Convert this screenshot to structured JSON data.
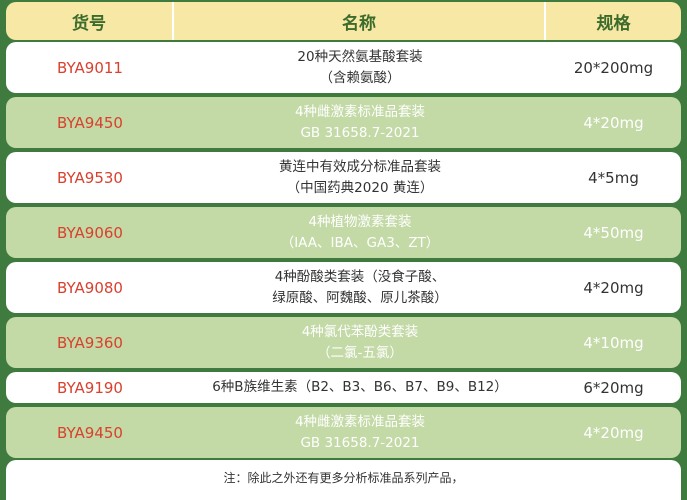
{
  "header": {
    "col_code": "货号",
    "col_name": "名称",
    "col_spec": "规格"
  },
  "rows": [
    {
      "code": "BYA9011",
      "name_line1": "20种天然氨基酸套装",
      "name_line2": "（含赖氨酸）",
      "spec": "20*200mg",
      "style": "white"
    },
    {
      "code": "BYA9450",
      "name_line1": "4种雌激素标准品套装",
      "name_line2": "GB 31658.7-2021",
      "spec": "4*20mg",
      "style": "green"
    },
    {
      "code": "BYA9530",
      "name_line1": "黄连中有效成分标准品套装",
      "name_line2": "（中国药典2020 黄连）",
      "spec": "4*5mg",
      "style": "white"
    },
    {
      "code": "BYA9060",
      "name_line1": "4种植物激素套装",
      "name_line2": "（IAA、IBA、GA3、ZT）",
      "spec": "4*50mg",
      "style": "green"
    },
    {
      "code": "BYA9080",
      "name_line1": "4种酚酸类套装（没食子酸、",
      "name_line2": "绿原酸、阿魏酸、原儿茶酸）",
      "spec": "4*20mg",
      "style": "white"
    },
    {
      "code": "BYA9360",
      "name_line1": "4种氯代苯酚类套装",
      "name_line2": "（二氯-五氯）",
      "spec": "4*10mg",
      "style": "green"
    },
    {
      "code": "BYA9190",
      "name_line1": "6种B族维生素（B2、B3、B6、B7、B9、B12）",
      "name_line2": "",
      "spec": "6*20mg",
      "style": "white"
    },
    {
      "code": "BYA9450",
      "name_line1": "4种雌激素标准品套装",
      "name_line2": "GB 31658.7-2021",
      "spec": "4*20mg",
      "style": "green"
    }
  ],
  "note": "注：除此之外还有更多分析标准品系列产品，"
}
